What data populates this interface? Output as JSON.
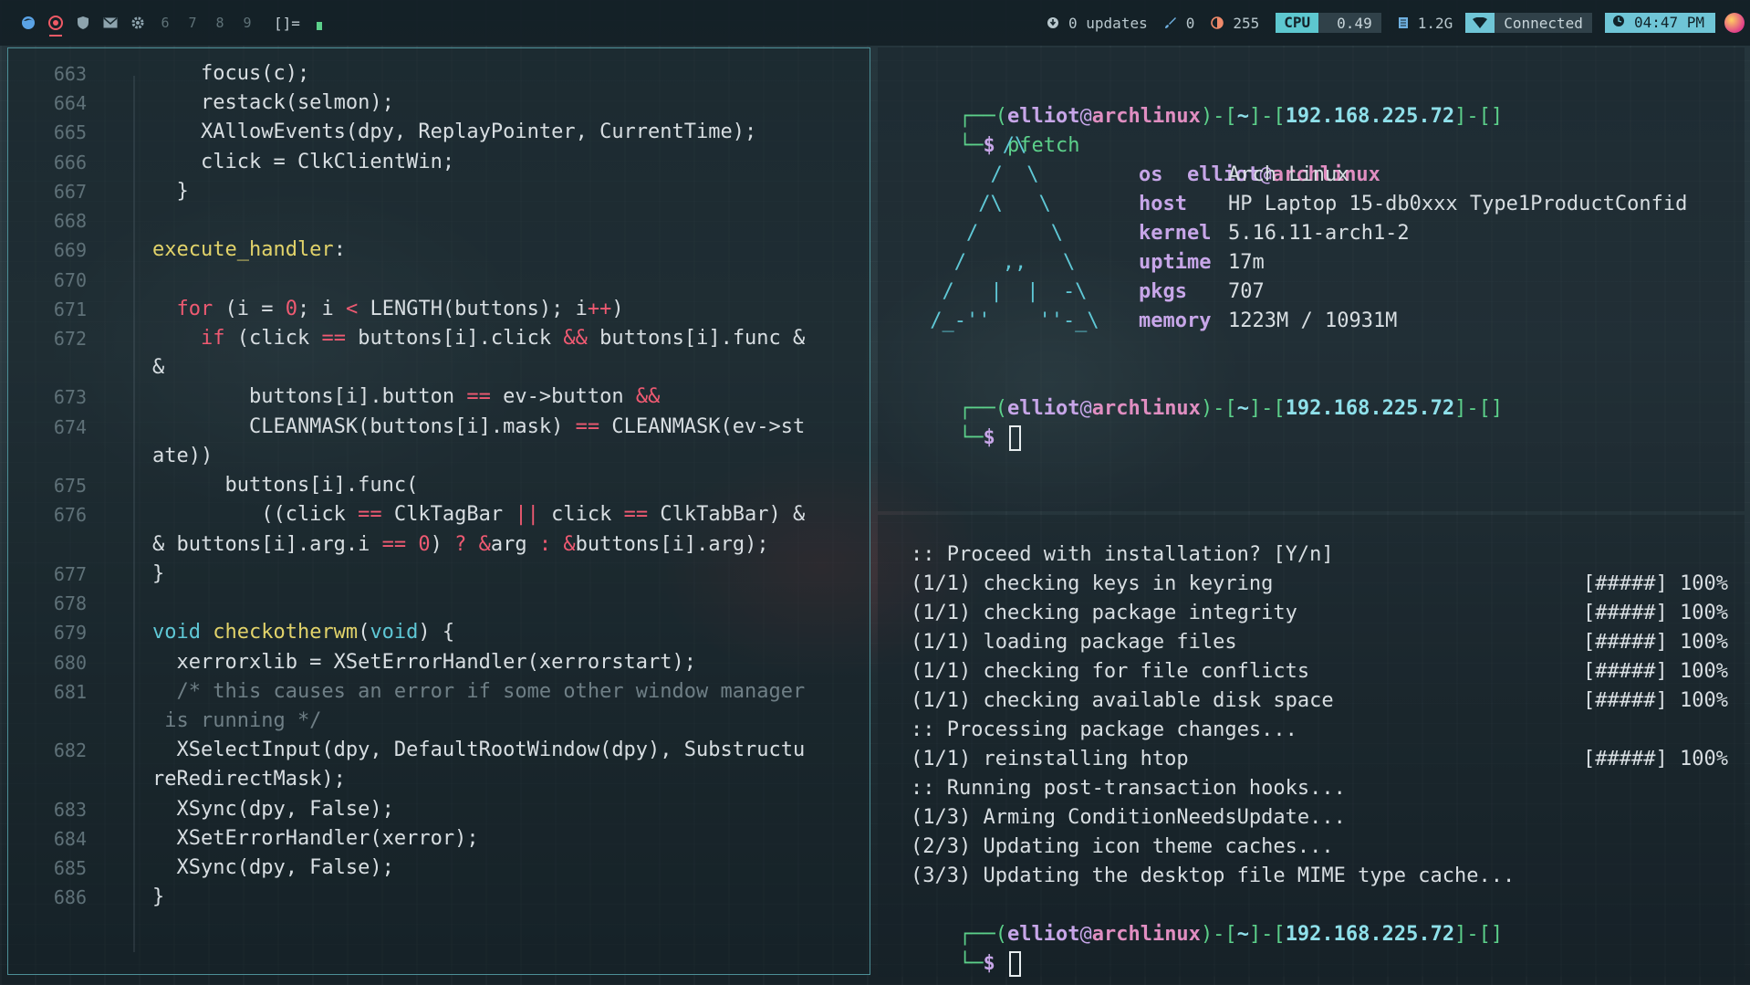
{
  "topbar": {
    "tags": [
      "firefox-icon",
      "chrome-icon",
      "shield-icon",
      "mail-icon",
      "gear-icon"
    ],
    "tag_numbers": [
      "6",
      "7",
      "8",
      "9"
    ],
    "layout_symbol": "[]=",
    "updates": "0 updates",
    "brush_count": "0",
    "brightness": "255",
    "cpu_label": "CPU",
    "cpu_value": "0.49",
    "mem_value": "1.2G",
    "wifi_status": "Connected",
    "time": "04:47 PM"
  },
  "editor": {
    "lines": [
      {
        "n": "663",
        "t": "    focus(c);"
      },
      {
        "n": "664",
        "t": "    restack(selmon);"
      },
      {
        "n": "665",
        "t": "    XAllowEvents(dpy, ReplayPointer, CurrentTime);"
      },
      {
        "n": "666",
        "t": "    click = ClkClientWin;"
      },
      {
        "n": "667",
        "t": "  }"
      },
      {
        "n": "668",
        "t": ""
      },
      {
        "n": "669",
        "t": "execute_handler:"
      },
      {
        "n": "670",
        "t": ""
      },
      {
        "n": "671",
        "t": "  for (i = 0; i < LENGTH(buttons); i++)"
      },
      {
        "n": "672",
        "t": "    if (click == buttons[i].click && buttons[i].func &"
      },
      {
        "n": "",
        "t": "&"
      },
      {
        "n": "673",
        "t": "        buttons[i].button == ev->button &&"
      },
      {
        "n": "674",
        "t": "        CLEANMASK(buttons[i].mask) == CLEANMASK(ev->st"
      },
      {
        "n": "",
        "t": "ate))"
      },
      {
        "n": "675",
        "t": "      buttons[i].func("
      },
      {
        "n": "676",
        "t": "         ((click == ClkTagBar || click == ClkTabBar) &"
      },
      {
        "n": "",
        "t": "& buttons[i].arg.i == 0) ? &arg : &buttons[i].arg);"
      },
      {
        "n": "677",
        "t": "}"
      },
      {
        "n": "678",
        "t": ""
      },
      {
        "n": "679",
        "t": "void checkotherwm(void) {"
      },
      {
        "n": "680",
        "t": "  xerrorxlib = XSetErrorHandler(xerrorstart);"
      },
      {
        "n": "681",
        "t": "  /* this causes an error if some other window manager"
      },
      {
        "n": "",
        "t": " is running */"
      },
      {
        "n": "682",
        "t": "  XSelectInput(dpy, DefaultRootWindow(dpy), Substructu"
      },
      {
        "n": "",
        "t": "reRedirectMask);"
      },
      {
        "n": "683",
        "t": "  XSync(dpy, False);"
      },
      {
        "n": "684",
        "t": "  XSetErrorHandler(xerror);"
      },
      {
        "n": "685",
        "t": "  XSync(dpy, False);"
      },
      {
        "n": "686",
        "t": "}"
      }
    ],
    "command_line": ":_"
  },
  "prompt": {
    "user": "elliot",
    "at": "@",
    "host": "archlinux",
    "path": "~",
    "ip": "192.168.225.72",
    "dollar": "$"
  },
  "term1": {
    "command": "pfetch",
    "logo": [
      "       /\\",
      "      /  \\",
      "     /\\   \\",
      "    /      \\",
      "   /   ,,   \\",
      "  /   |  |  -\\",
      " /_-''    ''-_\\"
    ],
    "info": [
      {
        "k": "os",
        "v": "Arch Linux"
      },
      {
        "k": "host",
        "v": "HP Laptop 15-db0xxx Type1ProductConfid"
      },
      {
        "k": "kernel",
        "v": "5.16.11-arch1-2"
      },
      {
        "k": "uptime",
        "v": "17m"
      },
      {
        "k": "pkgs",
        "v": "707"
      },
      {
        "k": "memory",
        "v": "1223M / 10931M"
      }
    ]
  },
  "term2": {
    "lines": [
      {
        "text": ":: Proceed with installation? [Y/n]",
        "progress": ""
      },
      {
        "text": "(1/1) checking keys in keyring",
        "progress": "[#####] 100%"
      },
      {
        "text": "(1/1) checking package integrity",
        "progress": "[#####] 100%"
      },
      {
        "text": "(1/1) loading package files",
        "progress": "[#####] 100%"
      },
      {
        "text": "(1/1) checking for file conflicts",
        "progress": "[#####] 100%"
      },
      {
        "text": "(1/1) checking available disk space",
        "progress": "[#####] 100%"
      },
      {
        "text": ":: Processing package changes...",
        "progress": ""
      },
      {
        "text": "(1/1) reinstalling htop",
        "progress": "[#####] 100%"
      },
      {
        "text": ":: Running post-transaction hooks...",
        "progress": ""
      },
      {
        "text": "(1/3) Arming ConditionNeedsUpdate...",
        "progress": ""
      },
      {
        "text": "(2/3) Updating icon theme caches...",
        "progress": ""
      },
      {
        "text": "(3/3) Updating the desktop file MIME type cache...",
        "progress": ""
      }
    ]
  },
  "colors": {
    "accent": "#5fc8d6",
    "red": "#ef5a72",
    "green": "#5cd08a",
    "purple": "#c7a6e8"
  }
}
